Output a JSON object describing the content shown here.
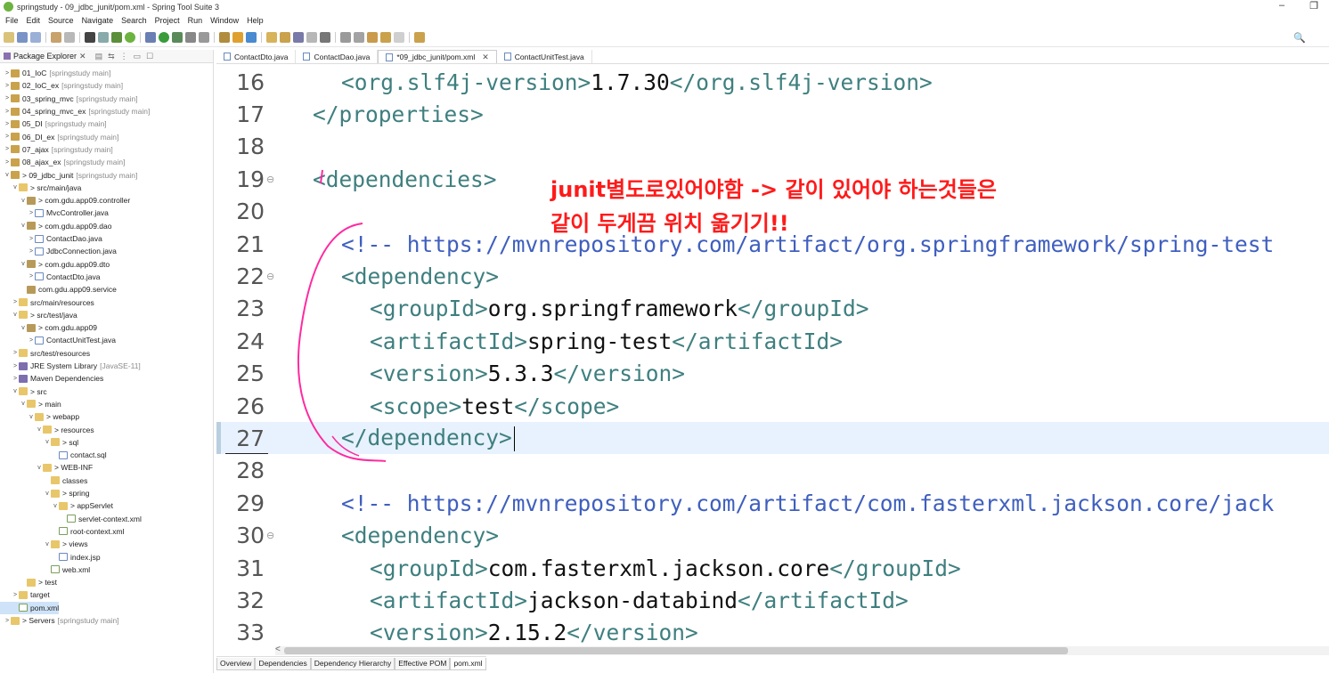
{
  "window": {
    "title": "springstudy - 09_jdbc_junit/pom.xml - Spring Tool Suite 3",
    "minimize": "–",
    "restore": "❐"
  },
  "menu": [
    "File",
    "Edit",
    "Source",
    "Navigate",
    "Search",
    "Project",
    "Run",
    "Window",
    "Help"
  ],
  "explorer": {
    "tab_label": "Package Explorer",
    "tree": [
      {
        "depth": 0,
        "twisty": ">",
        "icon": "project",
        "label": "01_IoC",
        "deco": "[springstudy main]"
      },
      {
        "depth": 0,
        "twisty": ">",
        "icon": "project",
        "label": "02_IoC_ex",
        "deco": "[springstudy main]"
      },
      {
        "depth": 0,
        "twisty": ">",
        "icon": "project",
        "label": "03_spring_mvc",
        "deco": "[springstudy main]"
      },
      {
        "depth": 0,
        "twisty": ">",
        "icon": "project",
        "label": "04_spring_mvc_ex",
        "deco": "[springstudy main]"
      },
      {
        "depth": 0,
        "twisty": ">",
        "icon": "project",
        "label": "05_DI",
        "deco": "[springstudy main]"
      },
      {
        "depth": 0,
        "twisty": ">",
        "icon": "project",
        "label": "06_DI_ex",
        "deco": "[springstudy main]"
      },
      {
        "depth": 0,
        "twisty": ">",
        "icon": "project",
        "label": "07_ajax",
        "deco": "[springstudy main]"
      },
      {
        "depth": 0,
        "twisty": ">",
        "icon": "project",
        "label": "08_ajax_ex",
        "deco": "[springstudy main]"
      },
      {
        "depth": 0,
        "twisty": "v",
        "icon": "project",
        "label": "> 09_jdbc_junit",
        "deco": "[springstudy main]"
      },
      {
        "depth": 1,
        "twisty": "v",
        "icon": "folder",
        "label": "> src/main/java",
        "deco": ""
      },
      {
        "depth": 2,
        "twisty": "v",
        "icon": "package",
        "label": "> com.gdu.app09.controller",
        "deco": ""
      },
      {
        "depth": 3,
        "twisty": ">",
        "icon": "java",
        "label": "MvcController.java",
        "deco": ""
      },
      {
        "depth": 2,
        "twisty": "v",
        "icon": "package",
        "label": "> com.gdu.app09.dao",
        "deco": ""
      },
      {
        "depth": 3,
        "twisty": ">",
        "icon": "java",
        "label": "ContactDao.java",
        "deco": ""
      },
      {
        "depth": 3,
        "twisty": ">",
        "icon": "java",
        "label": "JdbcConnection.java",
        "deco": ""
      },
      {
        "depth": 2,
        "twisty": "v",
        "icon": "package",
        "label": "> com.gdu.app09.dto",
        "deco": ""
      },
      {
        "depth": 3,
        "twisty": ">",
        "icon": "java",
        "label": "ContactDto.java",
        "deco": ""
      },
      {
        "depth": 2,
        "twisty": "",
        "icon": "package",
        "label": "com.gdu.app09.service",
        "deco": ""
      },
      {
        "depth": 1,
        "twisty": ">",
        "icon": "folder",
        "label": "src/main/resources",
        "deco": ""
      },
      {
        "depth": 1,
        "twisty": "v",
        "icon": "folder",
        "label": "> src/test/java",
        "deco": ""
      },
      {
        "depth": 2,
        "twisty": "v",
        "icon": "package",
        "label": "> com.gdu.app09",
        "deco": ""
      },
      {
        "depth": 3,
        "twisty": ">",
        "icon": "java",
        "label": "ContactUnitTest.java",
        "deco": ""
      },
      {
        "depth": 1,
        "twisty": ">",
        "icon": "folder",
        "label": "src/test/resources",
        "deco": ""
      },
      {
        "depth": 1,
        "twisty": ">",
        "icon": "library",
        "label": "JRE System Library",
        "deco": "[JavaSE-11]"
      },
      {
        "depth": 1,
        "twisty": ">",
        "icon": "library",
        "label": "Maven Dependencies",
        "deco": ""
      },
      {
        "depth": 1,
        "twisty": "v",
        "icon": "folder",
        "label": "> src",
        "deco": ""
      },
      {
        "depth": 2,
        "twisty": "v",
        "icon": "folder",
        "label": "> main",
        "deco": ""
      },
      {
        "depth": 3,
        "twisty": "v",
        "icon": "folder",
        "label": "> webapp",
        "deco": ""
      },
      {
        "depth": 4,
        "twisty": "v",
        "icon": "folder",
        "label": "> resources",
        "deco": ""
      },
      {
        "depth": 5,
        "twisty": "v",
        "icon": "folder",
        "label": "> sql",
        "deco": ""
      },
      {
        "depth": 6,
        "twisty": "",
        "icon": "file",
        "label": "contact.sql",
        "deco": ""
      },
      {
        "depth": 4,
        "twisty": "v",
        "icon": "folder",
        "label": "> WEB-INF",
        "deco": ""
      },
      {
        "depth": 5,
        "twisty": "",
        "icon": "folder",
        "label": "classes",
        "deco": ""
      },
      {
        "depth": 5,
        "twisty": "v",
        "icon": "folder",
        "label": "> spring",
        "deco": ""
      },
      {
        "depth": 6,
        "twisty": "v",
        "icon": "folder",
        "label": "> appServlet",
        "deco": ""
      },
      {
        "depth": 7,
        "twisty": "",
        "icon": "xml",
        "label": "servlet-context.xml",
        "deco": ""
      },
      {
        "depth": 6,
        "twisty": "",
        "icon": "xml",
        "label": "root-context.xml",
        "deco": ""
      },
      {
        "depth": 5,
        "twisty": "v",
        "icon": "folder",
        "label": "> views",
        "deco": ""
      },
      {
        "depth": 6,
        "twisty": "",
        "icon": "file",
        "label": "index.jsp",
        "deco": ""
      },
      {
        "depth": 5,
        "twisty": "",
        "icon": "xml",
        "label": "web.xml",
        "deco": ""
      },
      {
        "depth": 2,
        "twisty": "",
        "icon": "folder",
        "label": "> test",
        "deco": ""
      },
      {
        "depth": 1,
        "twisty": ">",
        "icon": "folder",
        "label": "target",
        "deco": ""
      },
      {
        "depth": 1,
        "twisty": "",
        "icon": "xml",
        "label": "pom.xml",
        "deco": "",
        "selected": true
      },
      {
        "depth": 0,
        "twisty": ">",
        "icon": "folder",
        "label": "> Servers",
        "deco": "[springstudy main]"
      }
    ]
  },
  "editor": {
    "tabs": [
      {
        "label": "ContactDto.java",
        "active": false,
        "close": ""
      },
      {
        "label": "ContactDao.java",
        "active": false,
        "close": ""
      },
      {
        "label": "*09_jdbc_junit/pom.xml",
        "active": true,
        "close": "✕"
      },
      {
        "label": "ContactUnitTest.java",
        "active": false,
        "close": ""
      }
    ],
    "lines": [
      {
        "n": "16",
        "fold": "",
        "indent": 2,
        "parts": [
          [
            "tag",
            "<org.slf4j-version>"
          ],
          [
            "val",
            "1.7.30"
          ],
          [
            "tag",
            "</org.slf4j-version>"
          ]
        ]
      },
      {
        "n": "17",
        "fold": "",
        "indent": 1,
        "parts": [
          [
            "tag",
            "</properties>"
          ]
        ]
      },
      {
        "n": "18",
        "fold": "",
        "indent": 0,
        "parts": []
      },
      {
        "n": "19",
        "fold": "⊖",
        "indent": 1,
        "parts": [
          [
            "tag",
            "<dependencies>"
          ]
        ]
      },
      {
        "n": "20",
        "fold": "",
        "indent": 0,
        "parts": []
      },
      {
        "n": "21",
        "fold": "",
        "indent": 2,
        "parts": [
          [
            "comment",
            "<!-- https://mvnrepository.com/artifact/org.springframework/spring-test"
          ]
        ]
      },
      {
        "n": "22",
        "fold": "⊖",
        "indent": 2,
        "parts": [
          [
            "tag",
            "<dependency>"
          ]
        ]
      },
      {
        "n": "23",
        "fold": "",
        "indent": 3,
        "parts": [
          [
            "tag",
            "<groupId>"
          ],
          [
            "val",
            "org.springframework"
          ],
          [
            "tag",
            "</groupId>"
          ]
        ]
      },
      {
        "n": "24",
        "fold": "",
        "indent": 3,
        "parts": [
          [
            "tag",
            "<artifactId>"
          ],
          [
            "val",
            "spring-test"
          ],
          [
            "tag",
            "</artifactId>"
          ]
        ]
      },
      {
        "n": "25",
        "fold": "",
        "indent": 3,
        "parts": [
          [
            "tag",
            "<version>"
          ],
          [
            "val",
            "5.3.3"
          ],
          [
            "tag",
            "</version>"
          ]
        ]
      },
      {
        "n": "26",
        "fold": "",
        "indent": 3,
        "parts": [
          [
            "tag",
            "<scope>"
          ],
          [
            "val",
            "test"
          ],
          [
            "tag",
            "</scope>"
          ]
        ]
      },
      {
        "n": "27",
        "fold": "",
        "indent": 2,
        "parts": [
          [
            "tag",
            "</dependency>"
          ]
        ],
        "current": true
      },
      {
        "n": "28",
        "fold": "",
        "indent": 0,
        "parts": []
      },
      {
        "n": "29",
        "fold": "",
        "indent": 2,
        "parts": [
          [
            "comment",
            "<!-- https://mvnrepository.com/artifact/com.fasterxml.jackson.core/jack"
          ]
        ]
      },
      {
        "n": "30",
        "fold": "⊖",
        "indent": 2,
        "parts": [
          [
            "tag",
            "<dependency>"
          ]
        ]
      },
      {
        "n": "31",
        "fold": "",
        "indent": 3,
        "parts": [
          [
            "tag",
            "<groupId>"
          ],
          [
            "val",
            "com.fasterxml.jackson.core"
          ],
          [
            "tag",
            "</groupId>"
          ]
        ]
      },
      {
        "n": "32",
        "fold": "",
        "indent": 3,
        "parts": [
          [
            "tag",
            "<artifactId>"
          ],
          [
            "val",
            "jackson-databind"
          ],
          [
            "tag",
            "</artifactId>"
          ]
        ]
      },
      {
        "n": "33",
        "fold": "",
        "indent": 3,
        "parts": [
          [
            "tag",
            "<version>"
          ],
          [
            "val",
            "2.15.2"
          ],
          [
            "tag",
            "</version>"
          ]
        ]
      }
    ],
    "annotation": {
      "line1": "junit별도로있어야함 -> 같이 있어야 하는것들은",
      "line2": "같이 두게끔 위치 옮기기!!",
      "color": "#ff1a1a"
    },
    "scroll_left": "<",
    "bottom_tabs": [
      {
        "label": "Overview",
        "active": false
      },
      {
        "label": "Dependencies",
        "active": false
      },
      {
        "label": "Dependency Hierarchy",
        "active": false
      },
      {
        "label": "Effective POM",
        "active": false
      },
      {
        "label": "pom.xml",
        "active": true
      }
    ]
  }
}
